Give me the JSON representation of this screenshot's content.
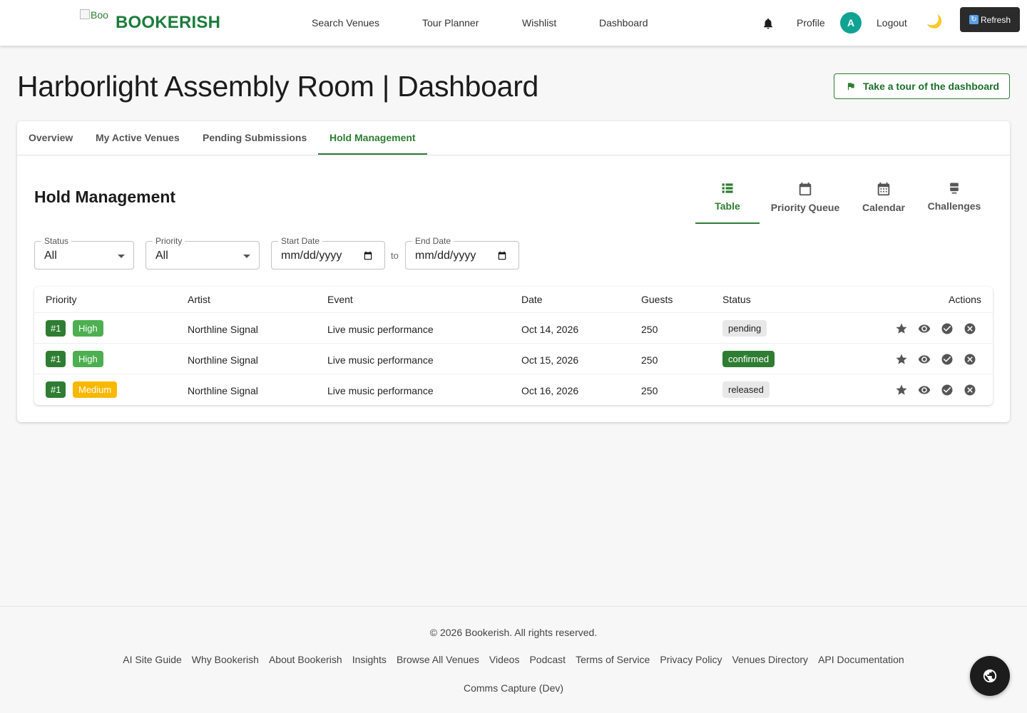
{
  "header": {
    "logo_alt": "Bookerish",
    "brand": "BOOKERISH",
    "nav": [
      "Search Venues",
      "Tour Planner",
      "Wishlist",
      "Dashboard"
    ],
    "profile": "Profile",
    "avatar_initial": "A",
    "logout": "Logout",
    "theme_icon": "moon-icon",
    "refresh": "Refresh"
  },
  "page": {
    "title": "Harborlight Assembly Room | Dashboard",
    "tour_button": "Take a tour of the dashboard"
  },
  "tabs": [
    "Overview",
    "My Active Venues",
    "Pending Submissions",
    "Hold Management"
  ],
  "active_tab": "Hold Management",
  "section": {
    "title": "Hold Management",
    "views": [
      "Table",
      "Priority Queue",
      "Calendar",
      "Challenges"
    ],
    "active_view": "Table"
  },
  "filters": {
    "status_label": "Status",
    "status_value": "All",
    "priority_label": "Priority",
    "priority_value": "All",
    "start_label": "Start Date",
    "start_placeholder": "mm/dd/yyyy",
    "to": "to",
    "end_label": "End Date",
    "end_placeholder": "mm/dd/yyyy"
  },
  "table": {
    "columns": [
      "Priority",
      "Artist",
      "Event",
      "Date",
      "Guests",
      "Status",
      "Actions"
    ],
    "rows": [
      {
        "rank": "#1",
        "priority": "High",
        "priority_color": "#4caf50",
        "artist": "Northline Signal",
        "event": "Live music performance",
        "date": "Oct 14, 2026",
        "guests": "250",
        "status": "pending",
        "status_bg": "#e8e8e8",
        "status_fg": "#222"
      },
      {
        "rank": "#1",
        "priority": "High",
        "priority_color": "#4caf50",
        "artist": "Northline Signal",
        "event": "Live music performance",
        "date": "Oct 15, 2026",
        "guests": "250",
        "status": "confirmed",
        "status_bg": "#2e7d32",
        "status_fg": "#ffffff"
      },
      {
        "rank": "#1",
        "priority": "Medium",
        "priority_color": "#f9b800",
        "artist": "Northline Signal",
        "event": "Live music performance",
        "date": "Oct 16, 2026",
        "guests": "250",
        "status": "released",
        "status_bg": "#e8e8e8",
        "status_fg": "#222"
      }
    ],
    "action_icons": [
      "star-icon",
      "eye-icon",
      "check-circle-icon",
      "cancel-circle-icon"
    ]
  },
  "footer": {
    "copyright": "© 2026 Bookerish. All rights reserved.",
    "links": [
      "AI Site Guide",
      "Why Bookerish",
      "About Bookerish",
      "Insights",
      "Browse All Venues",
      "Videos",
      "Podcast",
      "Terms of Service",
      "Privacy Policy",
      "Venues Directory",
      "API Documentation"
    ],
    "comms": "Comms Capture (Dev)"
  },
  "colors": {
    "brand": "#1b7d3a",
    "accent": "#2e7d32",
    "avatar": "#10a393"
  }
}
